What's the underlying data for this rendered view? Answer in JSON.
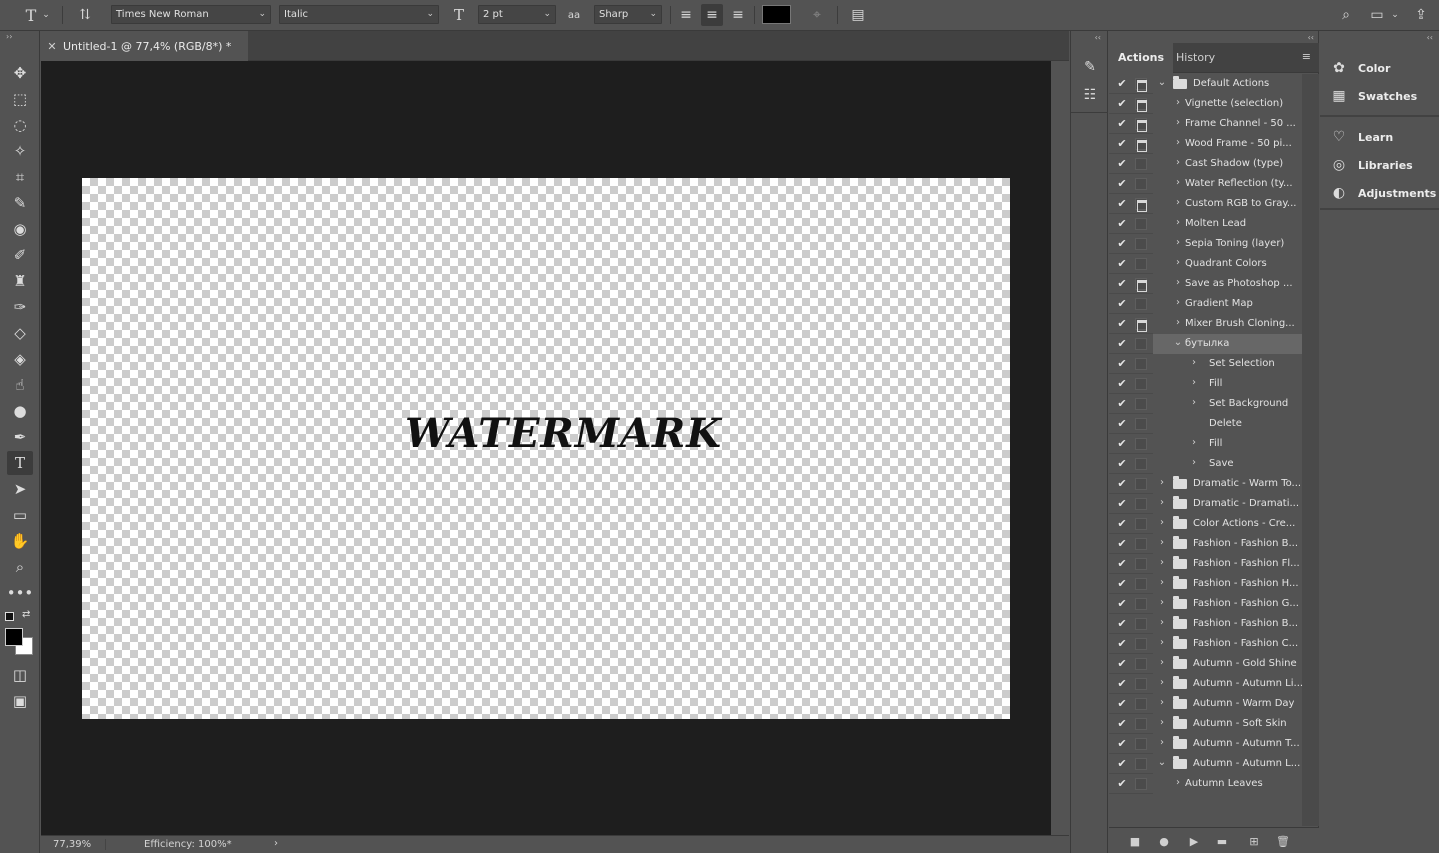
{
  "options_bar": {
    "tool_icon": "type-tool-icon",
    "font_family": "Times New Roman",
    "font_style": "Italic",
    "font_size": "2 pt",
    "anti_alias_icon": "aa",
    "anti_alias": "Sharp",
    "text_color": "#000000"
  },
  "document": {
    "tab_title": "Untitled-1 @ 77,4% (RGB/8*) *",
    "canvas_text": "WATERMARK"
  },
  "status": {
    "zoom": "77,39%",
    "efficiency": "Efficiency: 100%*"
  },
  "actions_panel": {
    "tabs": [
      "Actions",
      "History"
    ],
    "active_tab": "Actions",
    "rows": [
      {
        "label": "Default Actions",
        "level": 0,
        "type": "set",
        "expanded": true,
        "dialog": true
      },
      {
        "label": "Vignette (selection)",
        "level": 1,
        "type": "action",
        "expanded": false,
        "dialog": true
      },
      {
        "label": "Frame Channel - 50 ...",
        "level": 1,
        "type": "action",
        "expanded": false,
        "dialog": true
      },
      {
        "label": "Wood Frame - 50 pi...",
        "level": 1,
        "type": "action",
        "expanded": false,
        "dialog": true
      },
      {
        "label": "Cast Shadow (type)",
        "level": 1,
        "type": "action",
        "expanded": false,
        "dialog": false
      },
      {
        "label": "Water Reflection (ty...",
        "level": 1,
        "type": "action",
        "expanded": false,
        "dialog": false
      },
      {
        "label": "Custom RGB to Gray...",
        "level": 1,
        "type": "action",
        "expanded": false,
        "dialog": true
      },
      {
        "label": "Molten Lead",
        "level": 1,
        "type": "action",
        "expanded": false,
        "dialog": false
      },
      {
        "label": "Sepia Toning (layer)",
        "level": 1,
        "type": "action",
        "expanded": false,
        "dialog": false
      },
      {
        "label": "Quadrant Colors",
        "level": 1,
        "type": "action",
        "expanded": false,
        "dialog": false
      },
      {
        "label": "Save as Photoshop ...",
        "level": 1,
        "type": "action",
        "expanded": false,
        "dialog": true
      },
      {
        "label": "Gradient Map",
        "level": 1,
        "type": "action",
        "expanded": false,
        "dialog": false
      },
      {
        "label": "Mixer Brush Cloning...",
        "level": 1,
        "type": "action",
        "expanded": false,
        "dialog": true
      },
      {
        "label": "бутылка",
        "level": 1,
        "type": "action",
        "expanded": true,
        "dialog": false,
        "selected": true
      },
      {
        "label": "Set Selection",
        "level": 2,
        "type": "step",
        "expanded": false,
        "dialog": false
      },
      {
        "label": "Fill",
        "level": 2,
        "type": "step",
        "expanded": false,
        "dialog": false
      },
      {
        "label": "Set Background",
        "level": 2,
        "type": "step",
        "expanded": false,
        "dialog": false
      },
      {
        "label": "Delete",
        "level": 2,
        "type": "step",
        "expanded": null,
        "dialog": false
      },
      {
        "label": "Fill",
        "level": 2,
        "type": "step",
        "expanded": false,
        "dialog": false
      },
      {
        "label": "Save",
        "level": 2,
        "type": "step",
        "expanded": false,
        "dialog": false
      },
      {
        "label": "Dramatic - Warm To...",
        "level": 0,
        "type": "set",
        "expanded": false,
        "dialog": false
      },
      {
        "label": "Dramatic - Dramati...",
        "level": 0,
        "type": "set",
        "expanded": false,
        "dialog": false
      },
      {
        "label": "Color Actions - Cre...",
        "level": 0,
        "type": "set",
        "expanded": false,
        "dialog": false
      },
      {
        "label": "Fashion - Fashion B...",
        "level": 0,
        "type": "set",
        "expanded": false,
        "dialog": false
      },
      {
        "label": "Fashion - Fashion Fl...",
        "level": 0,
        "type": "set",
        "expanded": false,
        "dialog": false
      },
      {
        "label": "Fashion - Fashion H...",
        "level": 0,
        "type": "set",
        "expanded": false,
        "dialog": false
      },
      {
        "label": "Fashion - Fashion G...",
        "level": 0,
        "type": "set",
        "expanded": false,
        "dialog": false
      },
      {
        "label": "Fashion - Fashion B...",
        "level": 0,
        "type": "set",
        "expanded": false,
        "dialog": false
      },
      {
        "label": "Fashion - Fashion C...",
        "level": 0,
        "type": "set",
        "expanded": false,
        "dialog": false
      },
      {
        "label": "Autumn - Gold Shine",
        "level": 0,
        "type": "set",
        "expanded": false,
        "dialog": false
      },
      {
        "label": "Autumn - Autumn Li...",
        "level": 0,
        "type": "set",
        "expanded": false,
        "dialog": false
      },
      {
        "label": "Autumn - Warm Day",
        "level": 0,
        "type": "set",
        "expanded": false,
        "dialog": false
      },
      {
        "label": "Autumn - Soft Skin",
        "level": 0,
        "type": "set",
        "expanded": false,
        "dialog": false
      },
      {
        "label": "Autumn - Autumn T...",
        "level": 0,
        "type": "set",
        "expanded": false,
        "dialog": false
      },
      {
        "label": "Autumn - Autumn L...",
        "level": 0,
        "type": "set",
        "expanded": true,
        "dialog": false
      },
      {
        "label": "Autumn Leaves",
        "level": 1,
        "type": "action",
        "expanded": false,
        "dialog": false
      }
    ]
  },
  "right_panel": {
    "items": [
      {
        "label": "Color",
        "icon": "palette-icon"
      },
      {
        "label": "Swatches",
        "icon": "grid-icon"
      },
      {
        "label": "Learn",
        "icon": "lightbulb-icon"
      },
      {
        "label": "Libraries",
        "icon": "libraries-icon"
      },
      {
        "label": "Adjustments",
        "icon": "adjustments-icon"
      }
    ]
  }
}
